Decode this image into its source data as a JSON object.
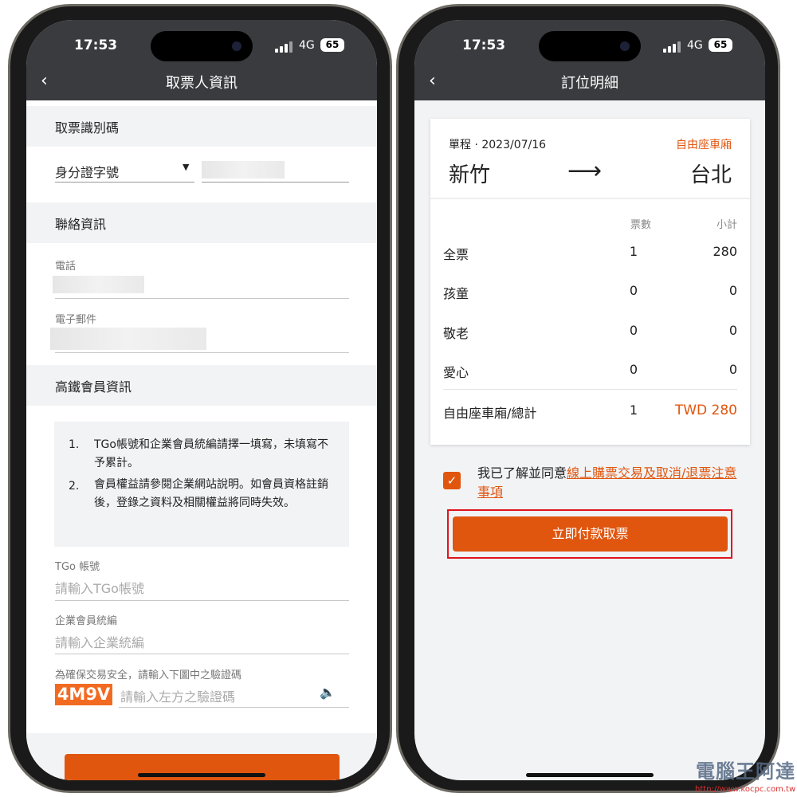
{
  "status": {
    "time": "17:53",
    "network": "4G",
    "battery": "65"
  },
  "left": {
    "title": "取票人資訊",
    "sections": {
      "pickup": "取票識別碼",
      "contact": "聯絡資訊",
      "member": "高鐵會員資訊"
    },
    "id_type": "身分證字號",
    "phone_label": "電話",
    "email_label": "電子郵件",
    "notes": [
      {
        "num": "1.",
        "text": "TGo帳號和企業會員統編請擇一填寫，未填寫不予累計。"
      },
      {
        "num": "2.",
        "text": "會員權益請參閱企業網站說明。如會員資格註銷後，登錄之資料及相關權益將同時失效。"
      }
    ],
    "tgo_label": "TGo 帳號",
    "tgo_placeholder": "請輸入TGo帳號",
    "corp_label": "企業會員統編",
    "corp_placeholder": "請輸入企業統編",
    "captcha_label": "為確保交易安全，請輸入下圖中之驗證碼",
    "captcha_code": "4M9V",
    "captcha_placeholder": "請輸入左方之驗證碼"
  },
  "right": {
    "title": "訂位明細",
    "trip": "單程 · 2023/07/16",
    "car_type": "自由座車廂",
    "from": "新竹",
    "arrow": "⟶",
    "to": "台北",
    "col_count": "票數",
    "col_subtotal": "小計",
    "rows": [
      {
        "type": "全票",
        "count": "1",
        "subtotal": "280"
      },
      {
        "type": "孩童",
        "count": "0",
        "subtotal": "0"
      },
      {
        "type": "敬老",
        "count": "0",
        "subtotal": "0"
      },
      {
        "type": "愛心",
        "count": "0",
        "subtotal": "0"
      }
    ],
    "total": {
      "label": "自由座車廂/總計",
      "count": "1",
      "amount": "TWD 280"
    },
    "agree_prefix": "我已了解並同意",
    "agree_link": "線上購票交易及取消/退票注意事項",
    "pay_button": "立即付款取票",
    "accent": "#e0560f"
  },
  "watermark": {
    "name": "電腦王阿達",
    "url": "http://www.kocpc.com.tw"
  }
}
